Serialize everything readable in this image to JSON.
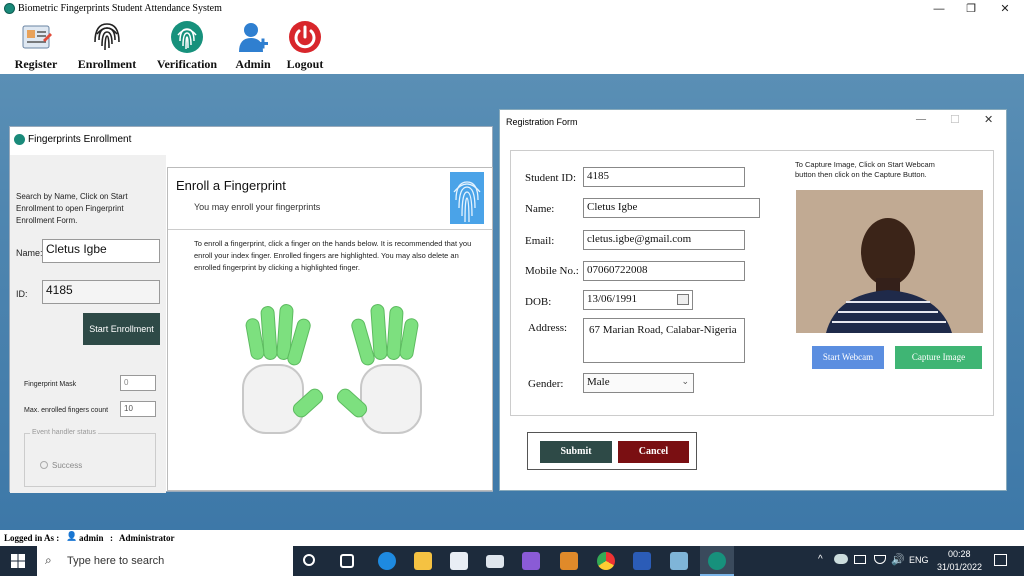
{
  "app": {
    "title": "Biometric Fingerprints Student Attendance System",
    "window_controls": {
      "minimize": "—",
      "maximize": "❐",
      "close": "✕"
    }
  },
  "toolbar": {
    "items": [
      {
        "label": "Register",
        "icon": "register-form-icon"
      },
      {
        "label": "Enrollment",
        "icon": "fingerprint-icon"
      },
      {
        "label": "Verification",
        "icon": "fingerprint-verify-icon"
      },
      {
        "label": "Admin",
        "icon": "admin-user-icon"
      },
      {
        "label": "Logout",
        "icon": "power-icon"
      }
    ]
  },
  "enrollment": {
    "window_title": "Fingerprints Enrollment",
    "instructions": "Search by Name, Click on Start Enrollment to open Fingerprint Enrollment Form.",
    "name_label": "Name:",
    "name_value": "Cletus Igbe",
    "id_label": "ID:",
    "id_value": "4185",
    "start_button": "Start Enrollment",
    "fingerprint_mask_label": "Fingerprint Mask",
    "fingerprint_mask_value": "0",
    "max_enrolled_label": "Max. enrolled fingers count",
    "max_enrolled_value": "10",
    "event_group_label": "Event handler status",
    "event_status": "Success",
    "panel_title": "Enroll a Fingerprint",
    "panel_subtitle": "You may enroll your fingerprints",
    "panel_text": "To enroll a fingerprint, click a finger on the hands below. It is recommended that you enroll your index finger. Enrolled fingers are highlighted. You may also delete an enrolled fingerprint by clicking a highlighted finger."
  },
  "registration": {
    "window_title": "Registration Form",
    "fields": {
      "student_id": {
        "label": "Student ID:",
        "value": "4185"
      },
      "name": {
        "label": "Name:",
        "value": "Cletus Igbe"
      },
      "email": {
        "label": "Email:",
        "value": "cletus.igbe@gmail.com"
      },
      "mobile": {
        "label": "Mobile No.:",
        "value": "07060722008"
      },
      "dob": {
        "label": "DOB:",
        "value": "13/06/1991"
      },
      "address": {
        "label": "Address:",
        "value": "67 Marian Road, Calabar-Nigeria"
      },
      "gender": {
        "label": "Gender:",
        "value": "Male"
      }
    },
    "capture_instructions": "To Capture Image, Click on Start Webcam button then click on the Capture Button.",
    "start_webcam": "Start Webcam",
    "capture_image": "Capture Image",
    "submit": "Submit",
    "cancel": "Cancel",
    "controls": {
      "minimize": "—",
      "maximize": "☐",
      "close": "✕"
    }
  },
  "status": {
    "logged_in_label": "Logged in As :",
    "user": "admin",
    "separator": ":",
    "role": "Administrator"
  },
  "taskbar": {
    "search_placeholder": "Type here to search",
    "language": "ENG",
    "time": "00:28",
    "date": "31/01/2022"
  },
  "colors": {
    "accent_dark": "#2e4a47",
    "cancel": "#7a0f12",
    "webcam_button": "#5b8ee0",
    "capture_button": "#3fb574",
    "desktop": "#4f86b0"
  }
}
